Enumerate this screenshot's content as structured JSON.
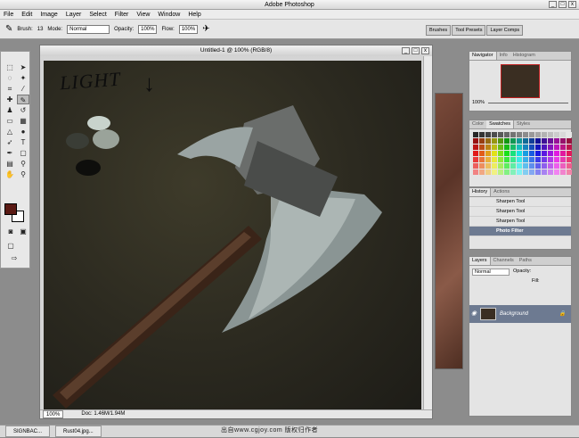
{
  "window": {
    "title": "Adobe Photoshop",
    "buttons": [
      "_",
      "□",
      "x"
    ]
  },
  "menu": [
    "File",
    "Edit",
    "Image",
    "Layer",
    "Select",
    "Filter",
    "View",
    "Window",
    "Help"
  ],
  "options": {
    "brush_label": "Brush:",
    "brush_size": "13",
    "mode_label": "Mode:",
    "mode_value": "Normal",
    "opacity_label": "Opacity:",
    "opacity_value": "100%",
    "flow_label": "Flow:",
    "flow_value": "100%"
  },
  "well_tabs": [
    "Brushes",
    "Tool Presets",
    "Layer Comps"
  ],
  "document": {
    "title": "Untitled-1 @ 100% (RGB/8)",
    "zoom": "100%",
    "doc_size": "Doc: 1.46M/1.94M",
    "canvas_text": "LIGHT"
  },
  "navigator": {
    "tabs": [
      "Navigator",
      "Info",
      "Histogram"
    ],
    "zoom": "100%"
  },
  "color_panel": {
    "tabs": [
      "Color",
      "Swatches",
      "Styles"
    ]
  },
  "history": {
    "tabs": [
      "History",
      "Actions"
    ],
    "items": [
      "Sharpen Tool",
      "Sharpen Tool",
      "Sharpen Tool",
      "Photo Filter"
    ]
  },
  "layers": {
    "tabs": [
      "Layers",
      "Channels",
      "Paths"
    ],
    "mode": "Normal",
    "opacity_label": "Opacity:",
    "fill_label": "Fill:",
    "layer_name": "Background"
  },
  "taskbar": [
    "SIGNBAC...",
    "Rust04.jpg..."
  ],
  "caption": "出自www.cgjoy.com 版权归作者"
}
